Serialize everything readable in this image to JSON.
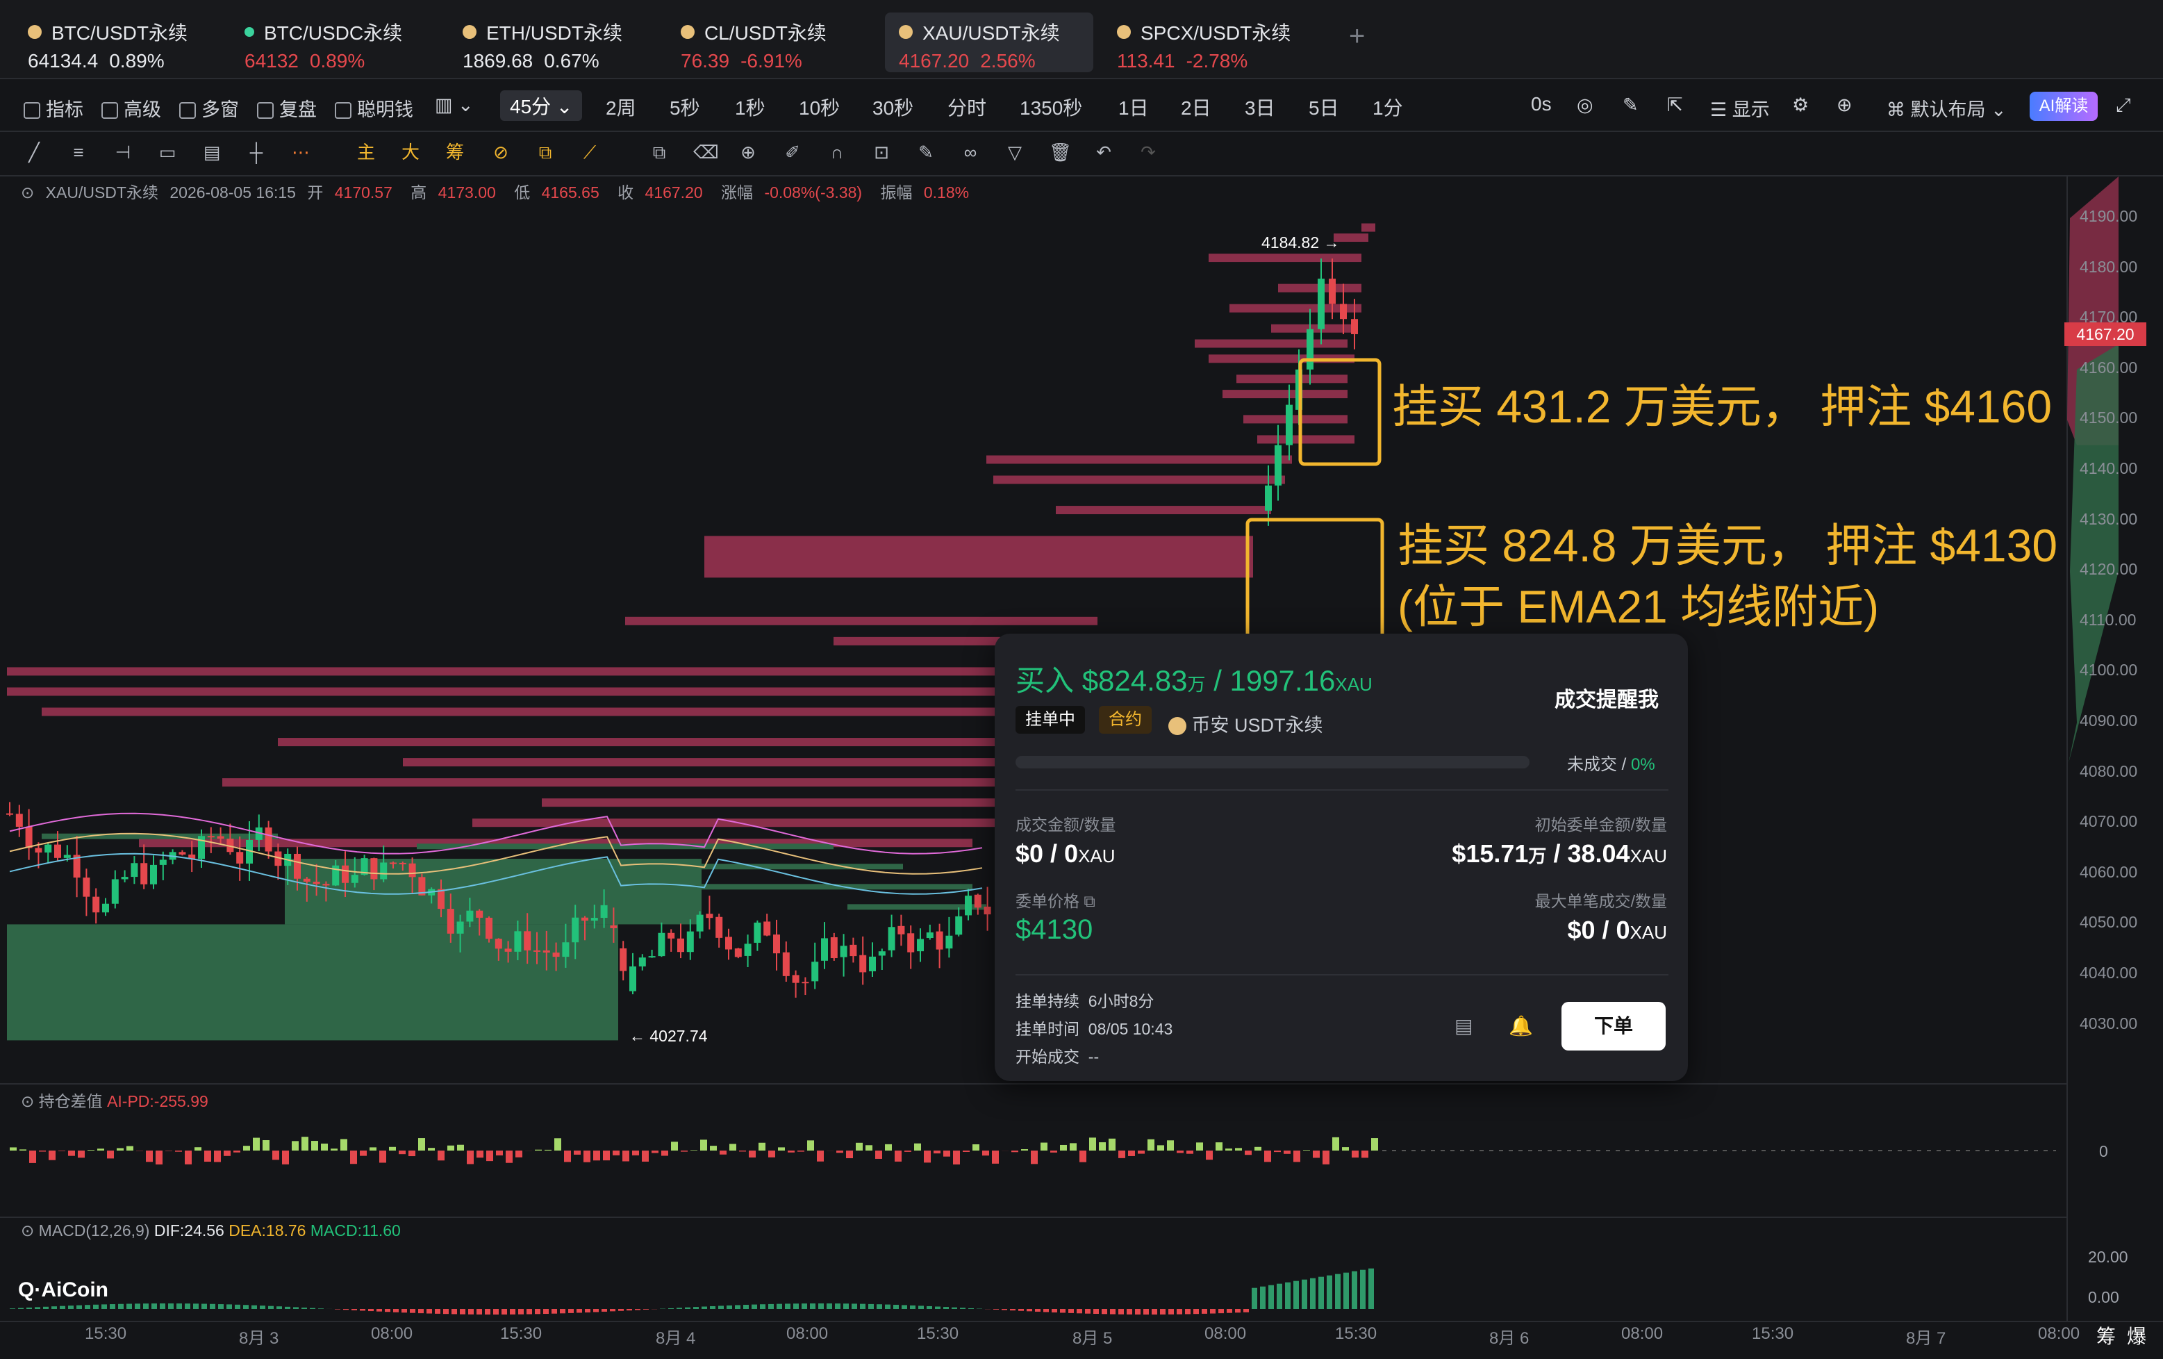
{
  "tickers": [
    {
      "name": "BTC/USDT永续",
      "price": "64134.4",
      "change": "0.89%",
      "price_color": "up"
    },
    {
      "name": "BTC/USDC永续",
      "price": "64132",
      "change": "0.89%",
      "price_color": "red"
    },
    {
      "name": "ETH/USDT永续",
      "price": "1869.68",
      "change": "0.67%",
      "price_color": "up"
    },
    {
      "name": "CL/USDT永续",
      "price": "76.39",
      "change": "-6.91%",
      "price_color": "red"
    },
    {
      "name": "XAU/USDT永续",
      "price": "4167.20",
      "change": "2.56%",
      "price_color": "red",
      "active": true
    },
    {
      "name": "SPCX/USDT永续",
      "price": "113.41",
      "change": "-2.78%",
      "price_color": "red"
    }
  ],
  "toolbar": {
    "indicators": "指标",
    "advanced": "高级",
    "multi": "多窗",
    "replay": "复盘",
    "smart_money": "聪明钱",
    "interval_selected": "45分",
    "intervals": [
      "2周",
      "5秒",
      "1秒",
      "10秒",
      "30秒",
      "分时",
      "1350秒",
      "1日",
      "2日",
      "3日",
      "5日",
      "1分"
    ],
    "countdown": "0s",
    "display": "显示",
    "layout": "默认布局",
    "ai": "AI解读"
  },
  "toolbar2": {
    "main": "主",
    "big": "大",
    "chips": "筹"
  },
  "legend": {
    "symbol": "XAU/USDT永续",
    "datetime": "2026-08-05 16:15",
    "open_label": "开",
    "open": "4170.57",
    "high_label": "高",
    "high": "4173.00",
    "low_label": "低",
    "low": "4165.65",
    "close_label": "收",
    "close": "4167.20",
    "change_label": "涨幅",
    "change": "-0.08%(-3.38)",
    "amp_label": "振幅",
    "amp": "0.18%"
  },
  "chart": {
    "high_marker": "4184.82 →",
    "low_marker": "← 4027.74",
    "current_price": "4167.20",
    "price_ticks": [
      "4190.00",
      "4180.00",
      "4170.00",
      "4160.00",
      "4150.00",
      "4140.00",
      "4130.00",
      "4120.00",
      "4110.00",
      "4100.00",
      "4090.00",
      "4080.00",
      "4070.00",
      "4060.00",
      "4050.00",
      "4040.00",
      "4030.00"
    ],
    "time_ticks": [
      "15:30",
      "8月 3",
      "08:00",
      "15:30",
      "8月 4",
      "08:00",
      "15:30",
      "8月 5",
      "08:00",
      "15:30",
      "8月 6",
      "08:00",
      "15:30",
      "8月 7",
      "08:00"
    ],
    "chip_labels": [
      "筹",
      "爆"
    ]
  },
  "annotations": {
    "line1": "挂买 431.2 万美元， 押注 $4160",
    "line2": "挂买 824.8 万美元， 押注 $4130",
    "line3": "(位于 EMA21 均线附近)"
  },
  "popup": {
    "title_side": "买入",
    "title_amount": "$824.83",
    "title_unit": "万",
    "title_sep": "/",
    "title_qty": "1997.16",
    "title_qty_unit": "XAU",
    "remind": "成交提醒我",
    "status": "挂单中",
    "type": "合约",
    "exchange": "币安 USDT永续",
    "fill_status": "未成交",
    "fill_pct": "0%",
    "filled_label": "成交金额/数量",
    "filled_value": "$0 / 0",
    "filled_unit": "XAU",
    "initial_label": "初始委单金额/数量",
    "initial_value": "$15.71",
    "initial_wan": "万",
    "initial_qty": "/ 38.04",
    "initial_unit": "XAU",
    "price_label": "委单价格",
    "price_value": "$4130",
    "max_label": "最大单笔成交/数量",
    "max_value": "$0 / 0",
    "max_unit": "XAU",
    "duration_label": "挂单持续",
    "duration": "6小时8分",
    "time_label": "挂单时间",
    "time": "08/05 10:43",
    "start_label": "开始成交",
    "start": "--",
    "order_btn": "下单"
  },
  "oi": {
    "label": "持仓差值",
    "value": "AI-PD:-255.99",
    "zero": "0"
  },
  "macd": {
    "label": "MACD(12,26,9)",
    "dif": "DIF:24.56",
    "dea": "DEA:18.76",
    "macd": "MACD:11.60",
    "ticks": [
      "20.00",
      "0.00"
    ]
  },
  "watermark": "AiCoin",
  "colors": {
    "up": "#22c27a",
    "down": "#e5484d",
    "bid_wall": "#8a2f4a",
    "ask_wall": "#2f6647",
    "accent": "#f2b62e"
  }
}
